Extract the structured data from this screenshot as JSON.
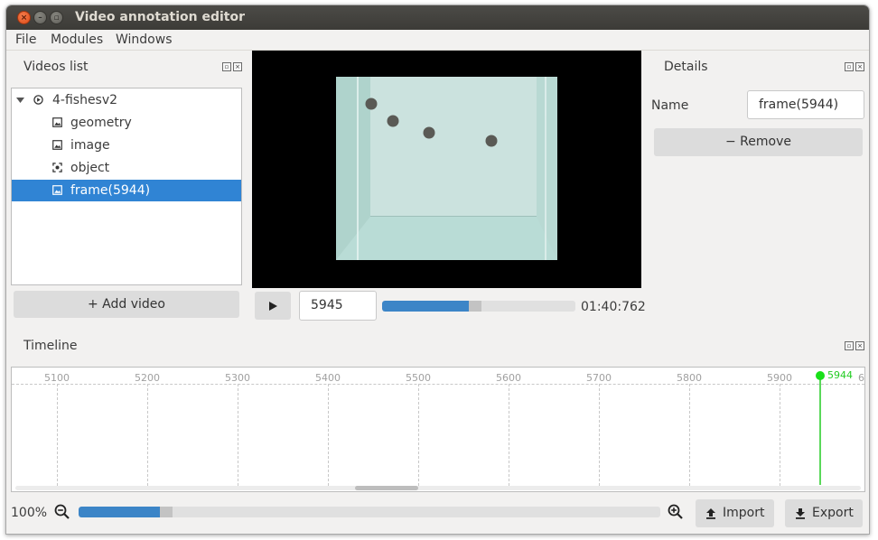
{
  "window": {
    "title": "Video annotation editor"
  },
  "menu": {
    "items": [
      "File",
      "Modules",
      "Windows"
    ]
  },
  "videos_panel": {
    "title": "Videos list",
    "tree": [
      {
        "label": "4-fishesv2",
        "icon": "play-circle-icon",
        "expanded": true
      },
      {
        "label": "geometry",
        "icon": "image-icon"
      },
      {
        "label": "image",
        "icon": "image-icon"
      },
      {
        "label": "object",
        "icon": "object-focus-icon"
      },
      {
        "label": "frame(5944)",
        "icon": "image-icon",
        "selected": true
      }
    ],
    "add_button": "+ Add video"
  },
  "player": {
    "frame_value": "5945",
    "progress": 0.45,
    "time": "01:40:762"
  },
  "details_panel": {
    "title": "Details",
    "name_label": "Name",
    "name_value": "frame(5944)",
    "remove_button": "−  Remove"
  },
  "timeline_panel": {
    "title": "Timeline",
    "ticks": [
      "5100",
      "5200",
      "5300",
      "5400",
      "5500",
      "5600",
      "5700",
      "5800",
      "5900",
      "6"
    ],
    "marker_label": "5944",
    "zoom_label": "100%",
    "zoom_progress": 0.14,
    "import_button": "Import",
    "export_button": "Export"
  },
  "colors": {
    "selection": "#3084d4",
    "marker": "#22dd22",
    "progress": "#3c85c7"
  }
}
